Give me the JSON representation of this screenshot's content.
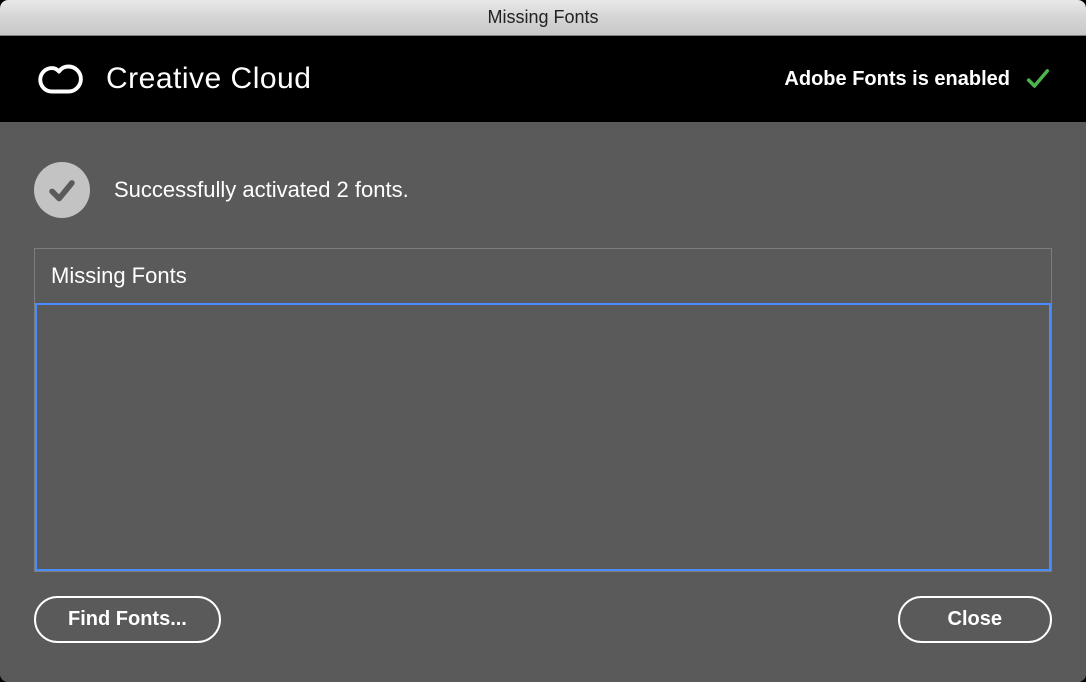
{
  "window": {
    "title": "Missing Fonts"
  },
  "header": {
    "brand": "Creative Cloud",
    "status_text": "Adobe Fonts is enabled"
  },
  "status": {
    "message": "Successfully activated 2 fonts."
  },
  "panel": {
    "title": "Missing Fonts",
    "items": []
  },
  "footer": {
    "find_fonts_label": "Find Fonts...",
    "close_label": "Close"
  }
}
